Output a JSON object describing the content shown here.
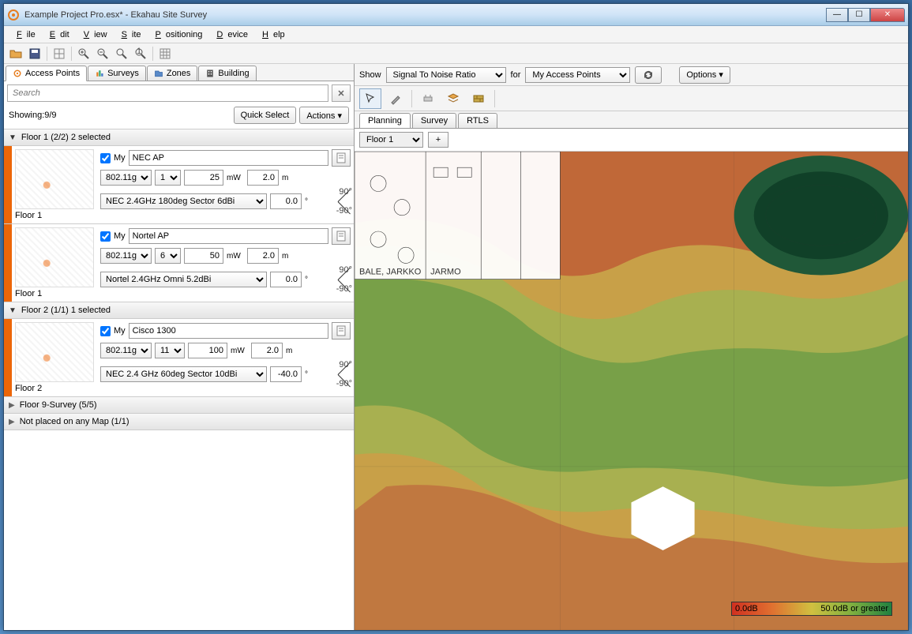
{
  "window": {
    "title": "Example Project Pro.esx* - Ekahau Site Survey"
  },
  "menu": [
    "File",
    "Edit",
    "View",
    "Site",
    "Positioning",
    "Device",
    "Help"
  ],
  "left_tabs": [
    {
      "label": "Access Points",
      "icon": "ap",
      "active": true
    },
    {
      "label": "Surveys",
      "icon": "surveys",
      "active": false
    },
    {
      "label": "Zones",
      "icon": "zones",
      "active": false
    },
    {
      "label": "Building",
      "icon": "building",
      "active": false
    }
  ],
  "search": {
    "placeholder": "Search"
  },
  "showing": "Showing:9/9",
  "quick_select": "Quick Select",
  "actions": "Actions ▾",
  "groups": [
    {
      "title": "Floor 1 (2/2) 2 selected",
      "open": true,
      "aps": [
        {
          "floor": "Floor 1",
          "my": true,
          "name": "NEC AP",
          "std": "802.11g",
          "ch": "1",
          "pw": "25",
          "pw_unit": "mW",
          "ht": "2.0",
          "ht_unit": "m",
          "antenna": "NEC 2.4GHz 180deg Sector 6dBi",
          "az": "0.0"
        },
        {
          "floor": "Floor 1",
          "my": true,
          "name": "Nortel AP",
          "std": "802.11g",
          "ch": "6",
          "pw": "50",
          "pw_unit": "mW",
          "ht": "2.0",
          "ht_unit": "m",
          "antenna": "Nortel 2.4GHz Omni 5.2dBi",
          "az": "0.0"
        }
      ]
    },
    {
      "title": "Floor 2 (1/1) 1 selected",
      "open": true,
      "aps": [
        {
          "floor": "Floor 2",
          "my": true,
          "name": "Cisco 1300",
          "std": "802.11g",
          "ch": "11",
          "pw": "100",
          "pw_unit": "mW",
          "ht": "2.0",
          "ht_unit": "m",
          "antenna": "NEC 2.4 GHz 60deg Sector 10dBi",
          "az": "-40.0"
        }
      ]
    },
    {
      "title": "Floor 9-Survey (5/5)",
      "open": false,
      "aps": []
    },
    {
      "title": "Not placed on any Map (1/1)",
      "open": false,
      "aps": []
    }
  ],
  "my_label": "My",
  "angle_top": "90°",
  "angle_bot": "-90°",
  "deg": "°",
  "right": {
    "show_label": "Show",
    "metric": "Signal To Noise Ratio",
    "for_label": "for",
    "scope": "My Access Points",
    "options": "Options ▾",
    "mode_tabs": [
      "Planning",
      "Survey",
      "RTLS"
    ],
    "active_mode": 0,
    "floor": "Floor 1",
    "plus": "+",
    "legend_min": "0.0dB",
    "legend_max": "50.0dB or greater",
    "floorplan_labels": [
      "BALE, JARKKO",
      "JARMO"
    ]
  }
}
